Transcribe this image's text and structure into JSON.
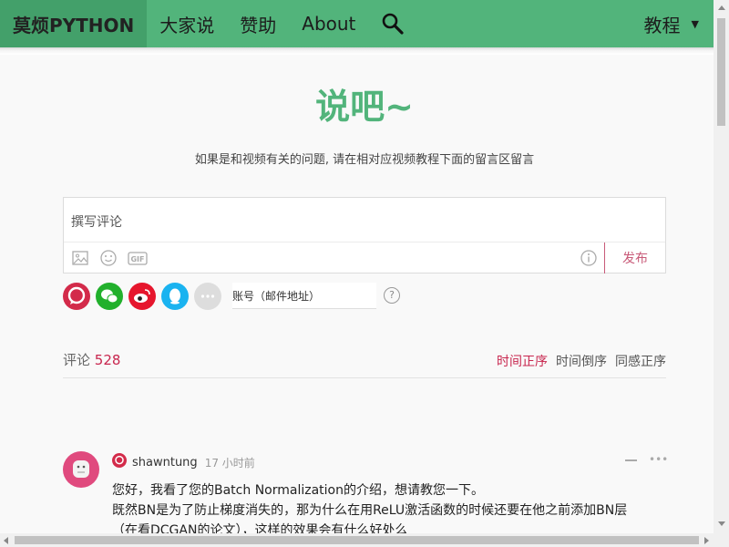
{
  "nav": {
    "brand": "莫烦PYTHON",
    "items": [
      "大家说",
      "赞助",
      "About"
    ],
    "right_label": "教程",
    "search_icon": "search-icon"
  },
  "hero": {
    "title": "说吧~",
    "subtitle": "如果是和视频有关的问题, 请在相对应视频教程下面的留言区留言"
  },
  "comment_box": {
    "placeholder": "撰写评论",
    "publish": "发布",
    "tools": [
      "image-icon",
      "emoji-icon",
      "gif-icon",
      "info-icon"
    ],
    "gif_label": "GIF"
  },
  "login": {
    "socials": [
      "duoshuo-icon",
      "wechat-icon",
      "weibo-icon",
      "qq-icon",
      "more-icon"
    ],
    "account_placeholder": "账号（邮件地址）",
    "help": "?"
  },
  "comments_header": {
    "label": "评论",
    "count": "528",
    "sorts": [
      "时间正序",
      "时间倒序",
      "同感正序"
    ],
    "active_sort": "时间正序"
  },
  "comment": {
    "username": "shawntung",
    "time": "17 小时前",
    "more": "•••",
    "lines": [
      "您好，我看了您的Batch Normalization的介绍，想请教您一下。",
      "既然BN是为了防止梯度消失的，那为什么在用ReLU激活函数的时候还要在他之前添加BN层",
      "（在看DCGAN的论文），这样的效果会有什么好处么"
    ]
  },
  "colors": {
    "brand_green": "#52b47b",
    "accent_red": "#c8264e",
    "publish_pink": "#c85a78"
  }
}
